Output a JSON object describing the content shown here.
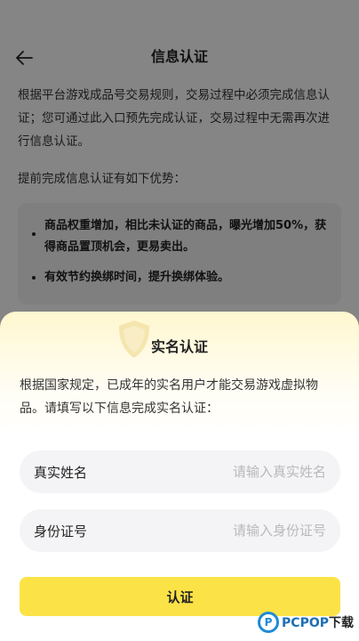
{
  "header": {
    "title": "信息认证"
  },
  "content": {
    "intro": "根据平台游戏成品号交易规则，交易过程中必须完成信息认证；您可通过此入口预先完成认证，交易过程中无需再次进行信息认证。",
    "advantages_heading": "提前完成信息认证有如下优势：",
    "advantages": [
      "商品权重增加，相比未认证的商品，曝光增加50%，获得商品置顶机会，更易卖出。",
      "有效节约换绑时间，提升换绑体验。"
    ]
  },
  "sheet": {
    "title": "实名认证",
    "description": "根据国家规定，已成年的实名用户才能交易游戏虚拟物品。请填写以下信息完成实名认证：",
    "name_field": {
      "label": "真实姓名",
      "placeholder": "请输入真实姓名",
      "value": ""
    },
    "id_field": {
      "label": "身份证号",
      "placeholder": "请输入身份证号",
      "value": ""
    },
    "submit_label": "认证"
  },
  "watermark": {
    "logo_letter": "P",
    "brand": "PCPOP",
    "suffix": "下载"
  },
  "colors": {
    "accent": "#fbe347",
    "field_bg": "#f4f4f6",
    "sheet_top": "#fff7cf"
  }
}
